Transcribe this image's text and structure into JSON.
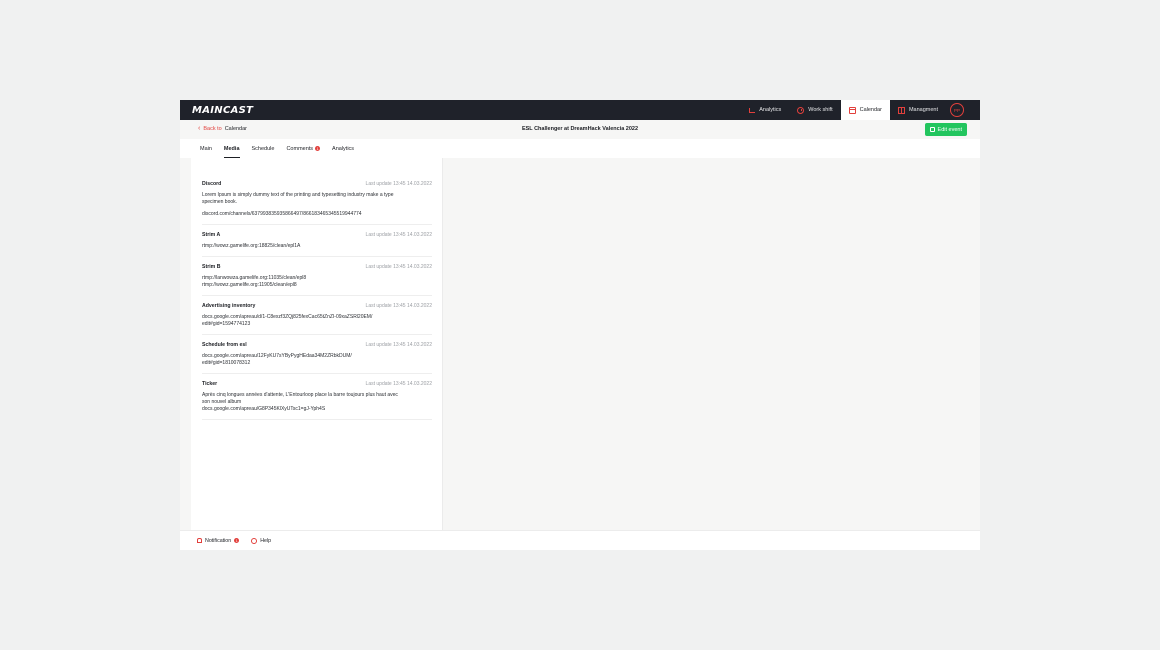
{
  "app": {
    "logo": "MAINCAST"
  },
  "nav": {
    "items": [
      {
        "label": "Analytics",
        "icon": "analytics-icon"
      },
      {
        "label": "Work shift",
        "icon": "clock-icon"
      },
      {
        "label": "Calendar",
        "icon": "calendar-icon",
        "active": true
      },
      {
        "label": "Managment",
        "icon": "management-icon"
      }
    ],
    "avatar_initials": "PP"
  },
  "subheader": {
    "back_prefix": "Back to",
    "back_target": "Calendar",
    "event_title": "ESL Challenger at DreamHack Valencia 2022",
    "edit_label": "Edit event"
  },
  "tabs": {
    "items": [
      {
        "label": "Main"
      },
      {
        "label": "Media",
        "active": true
      },
      {
        "label": "Schedule"
      },
      {
        "label": "Comments",
        "badge": "1"
      },
      {
        "label": "Analytics"
      }
    ]
  },
  "media": {
    "items": [
      {
        "title": "Discord",
        "updated": "Last update 13:45 14.03.2022",
        "lines": [
          "Lorem Ipsum is simply dummy text of the printing and typesetting industry make a type",
          "specimen book.",
          "",
          "discord.com/channels/637993835935866497/866183465345519944774"
        ]
      },
      {
        "title": "Strim A",
        "updated": "Last update 13:45 14.03.2022",
        "lines": [
          "rtmp://wowz.gamelife.org:18825/clean/epl1A"
        ]
      },
      {
        "title": "Strim B",
        "updated": "Last update 13:45 14.03.2022",
        "lines": [
          "rtmp://lanwowza.gamelife.org:11035/clean/epl8",
          "rtmp://wowz.gamelife.org:11905/clean/epl8"
        ]
      },
      {
        "title": "Advertising inventory",
        "updated": "Last update 13:45 14.03.2022",
        "lines": [
          "docs.google.com/apreau/d/1-C8exzf3ZQj825fexCac65tZnZI-09xaZSRl20EM/",
          "edit#gid=1594774123"
        ]
      },
      {
        "title": "Schedule from esl",
        "updated": "Last update 13:45 14.03.2022",
        "lines": [
          "docs.google.com/apreau/12FyKU7sYByPygHEdaa34M2ZRbkDUM/",
          "edit#gid=1810078312"
        ]
      },
      {
        "title": "Ticker",
        "updated": "Last update 13:45 14.03.2022",
        "lines": [
          "Après cinq longues années d'attente, L'Entourloop place la barre toujours plus haut avec",
          "son nouvel album",
          "docs.google.com/apreau/G8P345KlXyUTsc1=gJ-Yph4S"
        ]
      }
    ]
  },
  "footer": {
    "notification_label": "Notification",
    "notification_badge": "1",
    "help_label": "Help"
  },
  "colors": {
    "accent": "#e2403c",
    "success": "#22c55e",
    "topbar": "#1f222a"
  }
}
